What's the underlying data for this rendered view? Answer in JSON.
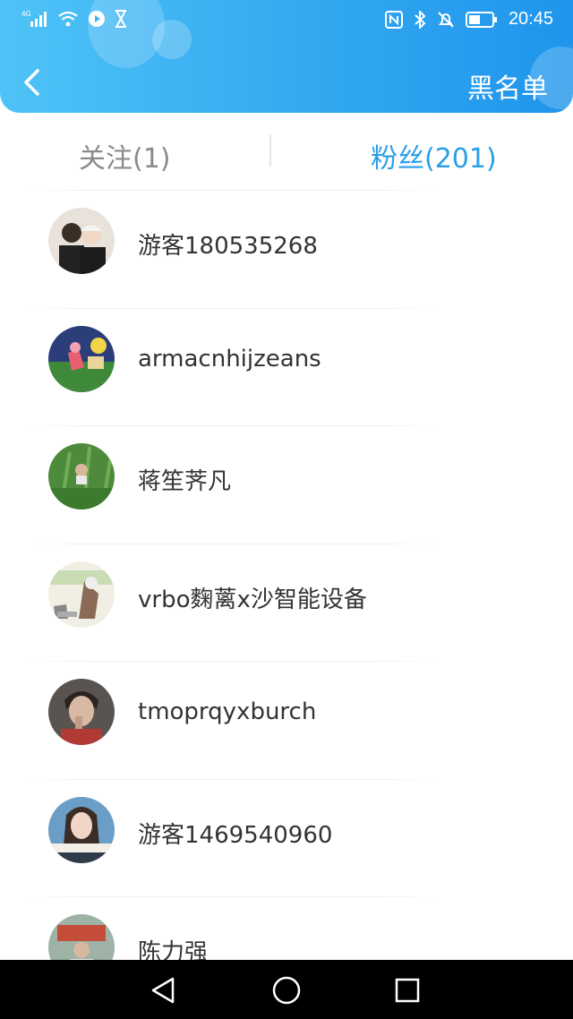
{
  "status_bar": {
    "network": "4G",
    "time": "20:45",
    "icons": [
      "signal-icon",
      "wifi-icon",
      "play-icon",
      "hourglass-icon",
      "nfc-icon",
      "bluetooth-icon",
      "mute-bell-icon",
      "battery-icon"
    ]
  },
  "header": {
    "back_icon": "chevron-left-icon",
    "blacklist_label": "黑名单",
    "accent_color": "#33a8f0"
  },
  "tabs": [
    {
      "label": "关注(1)",
      "active": false
    },
    {
      "label": "粉丝(201)",
      "active": true
    }
  ],
  "fans": [
    {
      "name": "游客180535268",
      "avatar": "couple-photo"
    },
    {
      "name": "armacnhijzeans",
      "avatar": "cartoon-illustration"
    },
    {
      "name": "蒋笙荠凡",
      "avatar": "person-in-grass"
    },
    {
      "name": "vrbo麴蓠x沙智能设备",
      "avatar": "sketch-drawing"
    },
    {
      "name": "tmoprqyxburch",
      "avatar": "portrait-man"
    },
    {
      "name": "游客1469540960",
      "avatar": "girl-portrait"
    },
    {
      "name": "陈力强",
      "avatar": "street-photo"
    }
  ],
  "system_nav": {
    "icons": [
      "back-triangle-icon",
      "home-circle-icon",
      "recent-square-icon"
    ]
  }
}
